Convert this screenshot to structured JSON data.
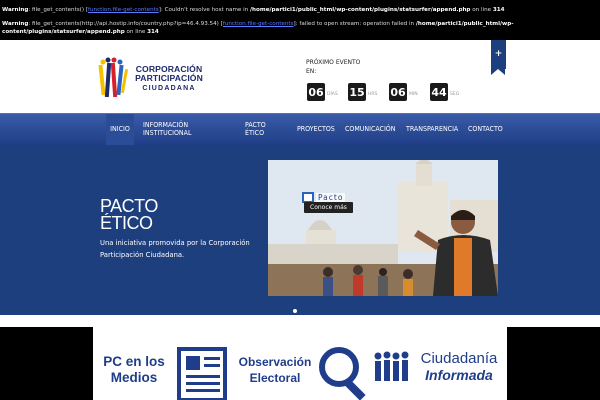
{
  "warnings": [
    {
      "prefix": "Warning",
      "text1": ": file_get_contents() [",
      "link": "function.file-get-contents",
      "text2": "]: Couldn't resolve host name in ",
      "path": "/home/partici1/public_html/wp-content/plugins/statsurfer/append.php",
      "text3": " on line ",
      "line": "314"
    },
    {
      "prefix": "Warning",
      "text1": ": file_get_contents(http://api.hostip.info/country.php?ip=46.4.93.54) [",
      "link": "function.file-get-contents",
      "text2": "]: failed to open stream: operation failed in ",
      "path": "/home/partici1/public_html/wp-content/plugins/statsurfer/append.php",
      "text3": " on line ",
      "line": "314"
    }
  ],
  "logo": {
    "line1": "CORPORACIÓN",
    "line2": "PARTICIPACIÓN",
    "line3": "CIUDADANA"
  },
  "evento": {
    "label_line1": "PRÓXIMO EVENTO",
    "label_line2": "EN:"
  },
  "countdown": [
    {
      "value": "06",
      "unit": "DÍAS"
    },
    {
      "value": "15",
      "unit": "HRS"
    },
    {
      "value": "06",
      "unit": "MIN"
    },
    {
      "value": "44",
      "unit": "SEG"
    }
  ],
  "ribbon": {
    "label": "+"
  },
  "nav": {
    "inicio": "INICIO",
    "info_1": "INFORMACIÓN",
    "info_2": "INSTITUCIONAL",
    "pacto_1": "PACTO",
    "pacto_2": "ÉTICO",
    "proyectos": "PROYECTOS",
    "comunicacion": "COMUNICACIÓN",
    "transparencia": "TRANSPARENCIA",
    "contacto": "CONTACTO"
  },
  "hero": {
    "title_line1": "PACTO",
    "title_line2": "ÉTICO",
    "subtitle": "Una iniciativa promovida por la Corporación Participación Ciudadana."
  },
  "slide": {
    "badge": "Pacto",
    "more": "Conoce más"
  },
  "banners": {
    "medios_1": "PC en los",
    "medios_2": "Medios",
    "obs_1": "Observación",
    "obs_2": "Electoral",
    "ciud_1": "Ciudadanía",
    "ciud_2": "Informada"
  },
  "colors": {
    "brand_blue": "#1e3f7e",
    "nav_active": "#2b4d97",
    "banner_text": "#1f3d8a"
  }
}
